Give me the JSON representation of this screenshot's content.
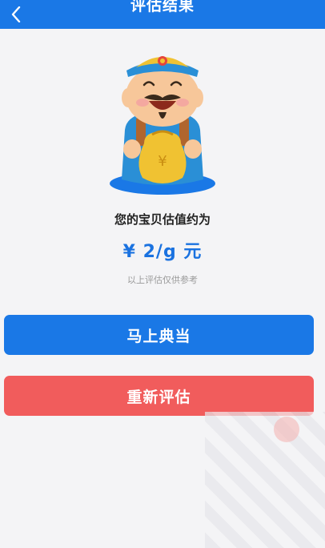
{
  "header": {
    "title": "评估结果",
    "back_icon": "chevron-left-icon",
    "background": "#1a78e6"
  },
  "mascot": {
    "icon": "fortune-god-mascot-icon"
  },
  "result": {
    "label": "您的宝贝估值约为",
    "amount": "¥ 2/g 元",
    "amount_color": "#1a72e0",
    "disclaimer": "以上评估仅供参考"
  },
  "actions": {
    "pawn_label": "马上典当",
    "pawn_color": "#1a78e6",
    "reevaluate_label": "重新评估",
    "reevaluate_color": "#f15c5c"
  }
}
